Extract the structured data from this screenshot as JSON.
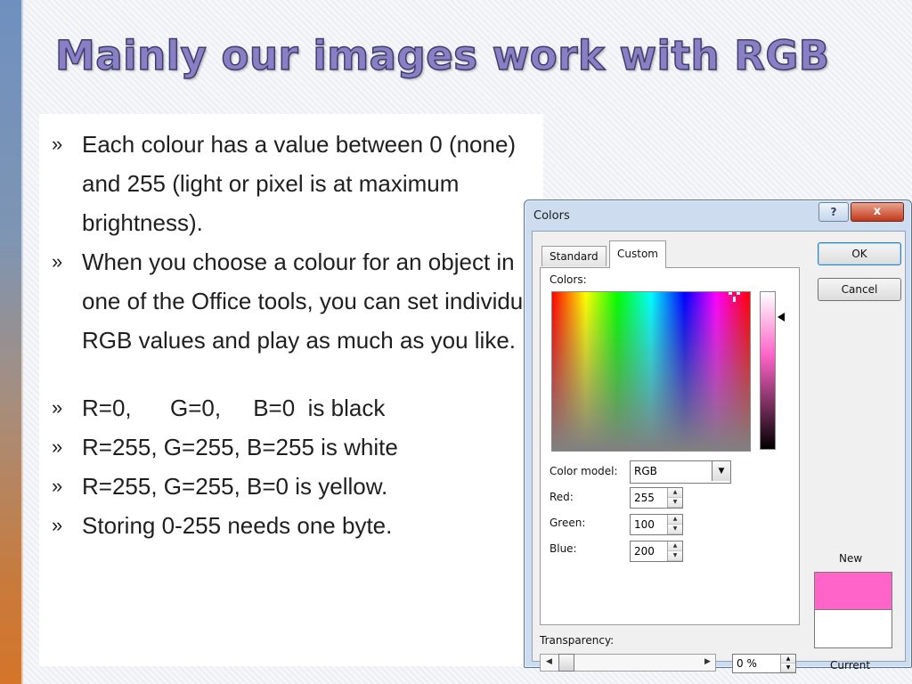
{
  "slide": {
    "title": "Mainly our images work with RGB",
    "bullet_marker": "»",
    "bullets": [
      "Each colour has a value between 0 (none) and 255 (light or pixel is at maximum brightness).",
      "When you choose a colour for an object in one of the Office tools, you can set individual RGB values and play as much as you like.",
      "R=0,      G=0,     B=0  is black",
      "R=255, G=255, B=255 is white",
      "R=255, G=255, B=0 is yellow.",
      "Storing 0-255 needs one byte."
    ]
  },
  "dialog": {
    "title": "Colors",
    "help_label": "?",
    "close_label": "x",
    "tabs": [
      {
        "label": "Standard",
        "active": false
      },
      {
        "label": "Custom",
        "active": true
      }
    ],
    "colors_label": "Colors:",
    "color_model_label": "Color model:",
    "color_model_value": "RGB",
    "red_label": "Red:",
    "red_value": "255",
    "green_label": "Green:",
    "green_value": "100",
    "blue_label": "Blue:",
    "blue_value": "200",
    "ok_label": "OK",
    "cancel_label": "Cancel",
    "new_label": "New",
    "current_label": "Current",
    "new_color": "#ff64c8",
    "current_color": "#ffffff",
    "transparency_label": "Transparency:",
    "transparency_value": "0 %",
    "transparency_level": 0
  },
  "colors": {
    "title_fill": "#8a7fc4",
    "title_outline": "#3c3f6e",
    "sidebar_top": "#6f90bf",
    "sidebar_bottom": "#d4752a"
  }
}
